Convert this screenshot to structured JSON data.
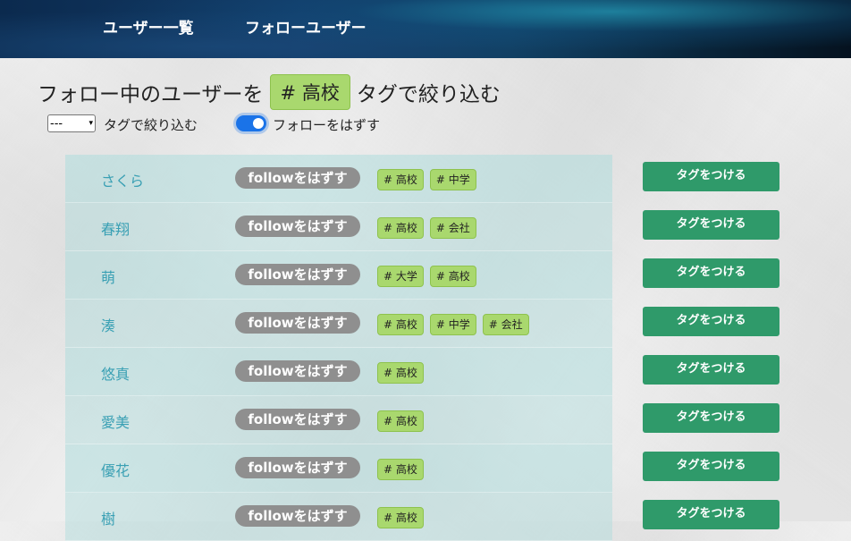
{
  "nav": {
    "users_link": "ユーザー一覧",
    "follow_link": "フォローユーザー"
  },
  "heading": {
    "prefix": "フォロー中のユーザーを",
    "tag": "# 高校",
    "suffix": "タグで絞り込む"
  },
  "filter": {
    "selected": "---",
    "label": "タグで絞り込む"
  },
  "toggle": {
    "label": "フォローをはずす",
    "on": true
  },
  "unfollow_label": "followをはずす",
  "tag_button_label": "タグをつける",
  "users": [
    {
      "name": "さくら",
      "tags": [
        "# 高校",
        "# 中学"
      ]
    },
    {
      "name": "春翔",
      "tags": [
        "# 高校",
        "# 会社"
      ]
    },
    {
      "name": "萌",
      "tags": [
        "# 大学",
        "# 高校"
      ]
    },
    {
      "name": "湊",
      "tags": [
        "# 高校",
        "# 中学",
        "# 会社"
      ]
    },
    {
      "name": "悠真",
      "tags": [
        "# 高校"
      ]
    },
    {
      "name": "愛美",
      "tags": [
        "# 高校"
      ]
    },
    {
      "name": "優花",
      "tags": [
        "# 高校"
      ]
    },
    {
      "name": "樹",
      "tags": [
        "# 高校"
      ]
    }
  ],
  "colors": {
    "tag_bg": "#a9d86e",
    "tag_button": "#2f9a6a",
    "unfollow_button": "#8f8f8f",
    "user_link": "#3aa0b4",
    "toggle": "#1a73e8"
  }
}
